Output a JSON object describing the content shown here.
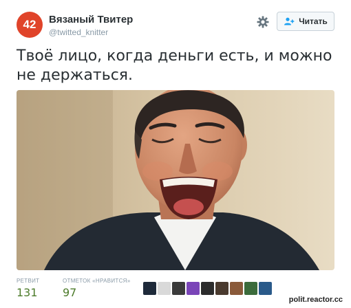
{
  "profile": {
    "avatar_text": "42",
    "name": "Вязаный Твитер",
    "handle": "@twitted_knitter"
  },
  "actions": {
    "follow_label": "Читать"
  },
  "tweet": {
    "text": "Твоё лицо, когда деньги есть, и можно не держаться."
  },
  "stats": {
    "retweets_label": "РЕТВИТ",
    "retweets_value": "131",
    "likes_label": "ОТМЕТОК «НРАВИТСЯ»",
    "likes_value": "97"
  },
  "likers": [
    {
      "color": "#1e2a3a"
    },
    {
      "color": "#d9d9d9"
    },
    {
      "color": "#3b3b3b"
    },
    {
      "color": "#7a45b8"
    },
    {
      "color": "#2c2c2c"
    },
    {
      "color": "#4a3a2e"
    },
    {
      "color": "#8a5a3a"
    },
    {
      "color": "#3b6b3b"
    },
    {
      "color": "#2a5a8a"
    }
  ],
  "watermark": "polit.reactor.cc",
  "colors": {
    "accent": "#1da1f2",
    "avatar_bg": "#e0442a",
    "stats_value": "#4c7b2a"
  }
}
